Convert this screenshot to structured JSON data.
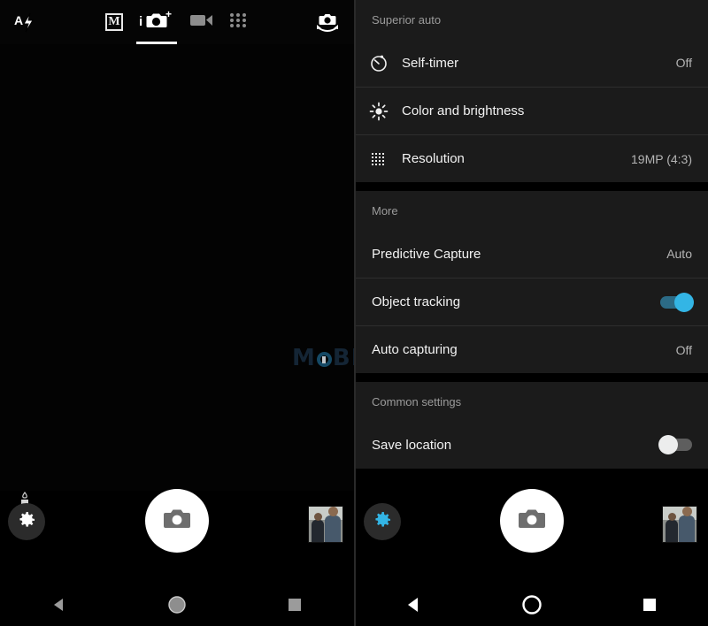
{
  "left_panel": {
    "topbar": {
      "flash_icon": "auto-flash-icon",
      "modes": [
        {
          "id": "manual",
          "label": "M",
          "icon": "manual-mode-icon",
          "selected": false
        },
        {
          "id": "superior-auto",
          "label": "",
          "icon": "superior-auto-camera-icon",
          "selected": true
        },
        {
          "id": "video",
          "label": "",
          "icon": "video-camera-icon",
          "selected": false
        },
        {
          "id": "apps",
          "label": "",
          "icon": "camera-apps-grid-icon",
          "selected": false
        }
      ],
      "switch_camera_icon": "switch-camera-icon"
    },
    "viewfinder": {
      "watermark_before": "M",
      "watermark_after": "BIG",
      "storage_icon": "internal-storage-icon"
    },
    "controls": {
      "settings_icon": "gear-icon",
      "shutter_icon": "camera-shutter-icon",
      "thumbnail_label": "last-photo-thumbnail"
    },
    "navbar": {
      "back": "back-triangle-icon",
      "home": "home-circle-icon",
      "recents": "recents-square-icon"
    }
  },
  "right_panel": {
    "settings": {
      "sections": [
        {
          "id": "superior-auto",
          "title": "Superior auto",
          "rows": [
            {
              "id": "self-timer",
              "icon": "self-timer-icon",
              "label": "Self-timer",
              "value": "Off",
              "control": "value"
            },
            {
              "id": "color-and-brightness",
              "icon": "brightness-icon",
              "label": "Color and brightness",
              "value": "",
              "control": "value"
            },
            {
              "id": "resolution",
              "icon": "resolution-grid-icon",
              "label": "Resolution",
              "value": "19MP (4:3)",
              "control": "value"
            }
          ]
        },
        {
          "id": "more",
          "title": "More",
          "rows": [
            {
              "id": "predictive-capture",
              "icon": "",
              "label": "Predictive Capture",
              "value": "Auto",
              "control": "value"
            },
            {
              "id": "object-tracking",
              "icon": "",
              "label": "Object tracking",
              "value": "",
              "control": "toggle-on"
            },
            {
              "id": "auto-capturing",
              "icon": "",
              "label": "Auto capturing",
              "value": "Off",
              "control": "value"
            }
          ]
        },
        {
          "id": "common-settings",
          "title": "Common settings",
          "rows": [
            {
              "id": "save-location",
              "icon": "",
              "label": "Save location",
              "value": "",
              "control": "toggle-off"
            }
          ]
        }
      ]
    },
    "controls": {
      "settings_icon": "gear-icon-active",
      "shutter_icon": "camera-shutter-icon",
      "thumbnail_label": "last-photo-thumbnail"
    },
    "navbar": {
      "back": "back-triangle-icon",
      "home": "home-circle-icon",
      "recents": "recents-square-icon"
    },
    "colors": {
      "accent": "#33b5e5",
      "panel_bg": "#1b1b1b",
      "divider": "#2e2e2e"
    }
  }
}
